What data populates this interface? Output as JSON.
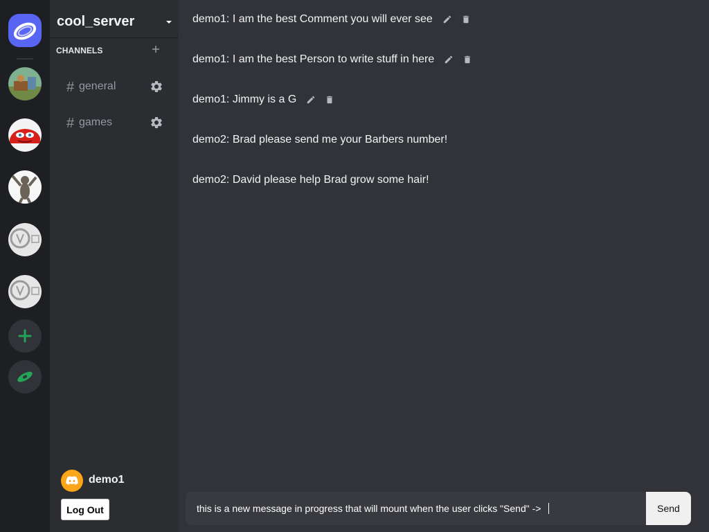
{
  "server": {
    "name": "cool_server"
  },
  "channels": {
    "header": "CHANNELS",
    "items": [
      {
        "name": "general"
      },
      {
        "name": "games"
      }
    ]
  },
  "messages": [
    {
      "author": "demo1",
      "text": "I am the best Comment you will ever see",
      "display": "demo1: I am the best Comment you will ever see",
      "editable": true
    },
    {
      "author": "demo1",
      "text": "I am the best Person to write stuff in here",
      "display": "demo1: I am the best Person to write stuff in here",
      "editable": true
    },
    {
      "author": "demo1",
      "text": "Jimmy is a G",
      "display": "demo1: Jimmy is a G",
      "editable": true
    },
    {
      "author": "demo2",
      "text": "Brad please send me your Barbers number!",
      "display": "demo2: Brad please send me your Barbers number!",
      "editable": false
    },
    {
      "author": "demo2",
      "text": "David please help Brad grow some hair!",
      "display": "demo2: David please help Brad grow some hair!",
      "editable": false
    }
  ],
  "composer": {
    "value": "this is a new message in progress that will mount when the user clicks \"Send\" ->",
    "send_label": "Send"
  },
  "user": {
    "name": "demo1",
    "logout_label": "Log Out"
  },
  "icons": {
    "server_list": [
      "bracelet-icon",
      "cartoon-yard-icon",
      "race-car-icon",
      "dancing-cat-icon",
      "placeholder-logo-icon",
      "placeholder-logo-icon"
    ],
    "add_server": "plus-icon",
    "explore": "compass-icon",
    "channel_settings": "gear-icon",
    "edit": "pencil-icon",
    "delete": "trash-icon"
  },
  "colors": {
    "blurple": "#5865f2",
    "green": "#23a559",
    "avatar": "#faa61a",
    "background": "#313338",
    "sidebar": "#2b2d31",
    "rail": "#1e1f22"
  }
}
